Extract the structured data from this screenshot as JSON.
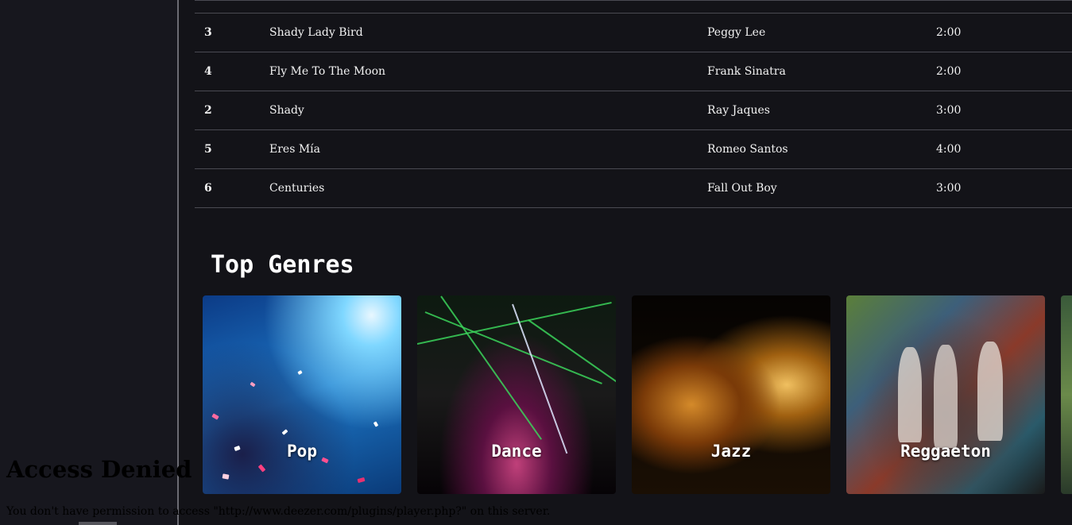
{
  "tracks": [
    {
      "num": "3",
      "title": "Shady Lady Bird",
      "artist": "Peggy Lee",
      "duration": "2:00"
    },
    {
      "num": "4",
      "title": "Fly Me To The Moon",
      "artist": "Frank Sinatra",
      "duration": "2:00"
    },
    {
      "num": "2",
      "title": "Shady",
      "artist": "Ray Jaques",
      "duration": "3:00"
    },
    {
      "num": "5",
      "title": "Eres Mía",
      "artist": "Romeo Santos",
      "duration": "4:00"
    },
    {
      "num": "6",
      "title": "Centuries",
      "artist": "Fall Out Boy",
      "duration": "3:00"
    }
  ],
  "genres": {
    "title": "Top Genres",
    "items": [
      {
        "label": "Pop"
      },
      {
        "label": "Dance"
      },
      {
        "label": "Jazz"
      },
      {
        "label": "Reggaeton"
      }
    ]
  },
  "error": {
    "title": "Access Denied",
    "message": "You don't have permission to access \"http://www.deezer.com/plugins/player.php?\" on this server."
  },
  "colors": {
    "background": "#131318",
    "sidebar": "#17171e",
    "text": "#f2f2f2",
    "divider": "#4a4a52"
  }
}
